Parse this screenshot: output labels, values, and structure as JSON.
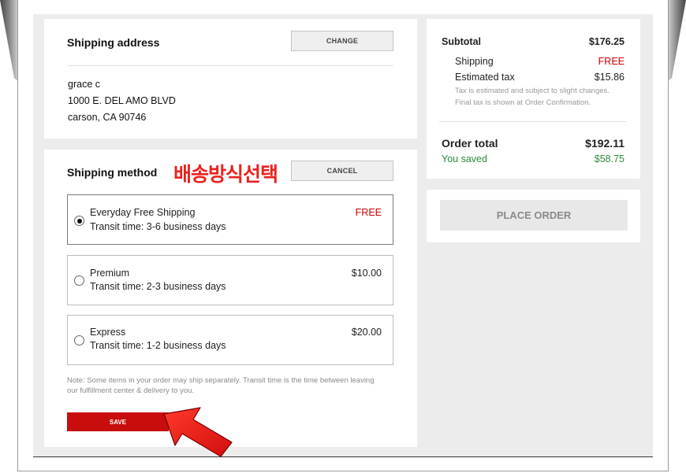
{
  "shipping_address": {
    "title": "Shipping address",
    "change_label": "CHANGE",
    "name": "grace c",
    "street": "1000 E. DEL AMO BLVD",
    "city_state_zip": "carson, CA 90746"
  },
  "shipping_method": {
    "title": "Shipping method",
    "annotation": "배송방식선택",
    "cancel_label": "CANCEL",
    "options": [
      {
        "name": "Everyday Free Shipping",
        "transit": "Transit time: 3-6 business days",
        "price": "FREE",
        "selected": true
      },
      {
        "name": "Premium",
        "transit": "Transit time: 2-3 business days",
        "price": "$10.00",
        "selected": false
      },
      {
        "name": "Express",
        "transit": "Transit time: 1-2 business days",
        "price": "$20.00",
        "selected": false
      }
    ],
    "note": "Note: Some items in your order may ship separately. Transit time is the time between leaving our fulfillment center & delivery to you.",
    "save_label": "SAVE"
  },
  "summary": {
    "subtotal_label": "Subtotal",
    "subtotal_value": "$176.25",
    "shipping_label": "Shipping",
    "shipping_value": "FREE",
    "tax_label": "Estimated tax",
    "tax_value": "$15.86",
    "tax_note_1": "Tax is estimated and subject to slight changes.",
    "tax_note_2": "Final tax is shown at Order Confirmation.",
    "total_label": "Order total",
    "total_value": "$192.11",
    "saved_label": "You saved",
    "saved_value": "$58.75"
  },
  "place_order_label": "PLACE ORDER",
  "colors": {
    "accent_red": "#c80d0d",
    "free_red": "#cc0000",
    "saved_green": "#2e8b3a",
    "annotation_red": "#e8231f"
  },
  "icons": {
    "pointer_arrow": "red-arrow-icon"
  }
}
